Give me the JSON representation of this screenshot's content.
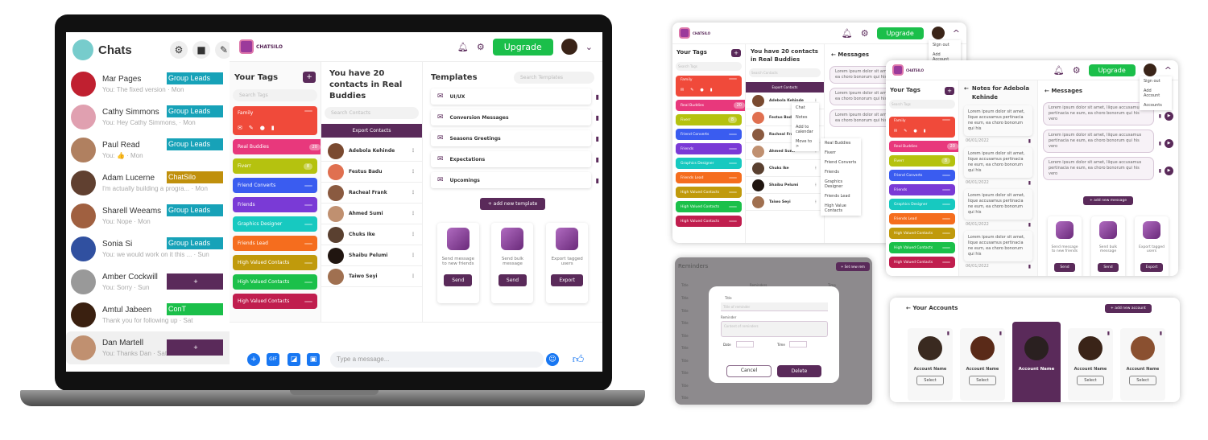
{
  "colors": {
    "brand": "#5a2a5a",
    "upgrade": "#1bbf4a",
    "messenger": "#1877f2"
  },
  "brand": {
    "logo_text": "CHATSILO"
  },
  "messenger": {
    "title": "Chats",
    "icons": [
      "gear-icon",
      "video-icon",
      "compose-icon"
    ],
    "chats": [
      {
        "name": "Mar Pages",
        "preview": "You: The fixed version · Mon",
        "tag": "Group Leads",
        "tag_color": "#17a2b8",
        "avatar": "#c02030"
      },
      {
        "name": "Cathy Simmons",
        "preview": "You: Hey Cathy Simmons,      · Mon",
        "tag": "Group Leads",
        "tag_color": "#17a2b8",
        "avatar": "#e0a0b0"
      },
      {
        "name": "Paul Read",
        "preview": "You: 👍 · Mon",
        "tag": "Group Leads",
        "tag_color": "#17a2b8",
        "avatar": "#b08060"
      },
      {
        "name": "Adam Lucerne",
        "preview": "I'm actually building a progra... · Mon",
        "tag": "ChatSilo",
        "tag_color": "#c0900c",
        "avatar": "#604030"
      },
      {
        "name": "Sharell Weeams",
        "preview": "You: Nope · Mon",
        "tag": "Group Leads",
        "tag_color": "#17a2b8",
        "avatar": "#a06040"
      },
      {
        "name": "Sonia Si",
        "preview": "You: we would work on it this ... · Sun",
        "tag": "Group Leads",
        "tag_color": "#17a2b8",
        "avatar": "#3050a0"
      },
      {
        "name": "Amber Cockwill",
        "preview": "You: Sorry · Sun",
        "tag": "+",
        "tag_color": "#5a2a5a",
        "avatar": "#999"
      },
      {
        "name": "Amtul Jabeen",
        "preview": "Thank you for following up · Sat",
        "tag": "ConT",
        "tag_color": "#1bbf4a",
        "avatar": "#3a2010"
      },
      {
        "name": "Dan Martell",
        "preview": "You: Thanks Dan · Sat",
        "tag": "+",
        "tag_color": "#5a2a5a",
        "avatar": "#c09070"
      }
    ],
    "composer_placeholder": "Type a message...",
    "composer_icons": [
      "plus-icon",
      "gif-icon",
      "sticker-icon",
      "image-icon",
      "emoji-icon",
      "thumbs-up-icon"
    ]
  },
  "app": {
    "upgrade": "Upgrade",
    "tags_title": "Your Tags",
    "add": "+",
    "search_tags": "Search Tags",
    "contacts_title": "You have 20 contacts in Real Buddies",
    "search_contacts": "Search Contacts",
    "export_contacts": "Export Contacts",
    "tags": [
      {
        "label": "Family",
        "color": "#f04a3a",
        "count": ""
      },
      {
        "label": "Real Buddies",
        "color": "#e8387c",
        "count": "20"
      },
      {
        "label": "Fiverr",
        "color": "#b5c20f",
        "count": "8"
      },
      {
        "label": "Friend Converts",
        "color": "#3a5cf0",
        "count": ""
      },
      {
        "label": "Friends",
        "color": "#7a3ad6",
        "count": ""
      },
      {
        "label": "Graphics Designer",
        "color": "#17c9c0",
        "count": ""
      },
      {
        "label": "Friends Lead",
        "color": "#f56d1e",
        "count": ""
      },
      {
        "label": "High Valued Contacts",
        "color": "#c09a0c",
        "count": ""
      },
      {
        "label": "High Valued Contacts",
        "color": "#1bc04a",
        "count": ""
      },
      {
        "label": "High Valued Contacts",
        "color": "#c01e4e",
        "count": ""
      }
    ],
    "contacts": [
      {
        "name": "Adebola Kehinde",
        "avatar": "#7a4a30"
      },
      {
        "name": "Festus Badu",
        "avatar": "#e07050"
      },
      {
        "name": "Racheal Frank",
        "avatar": "#8a5a40"
      },
      {
        "name": "Ahmed Sumi",
        "avatar": "#c09070"
      },
      {
        "name": "Chuks Ike",
        "avatar": "#5a4030"
      },
      {
        "name": "Shaibu Pelumi",
        "avatar": "#201510"
      },
      {
        "name": "Taiwo Seyi",
        "avatar": "#a07050"
      }
    ],
    "templates_title": "Templates",
    "search_templates": "Search Templates",
    "templates": [
      "UI/UX",
      "Conversion Messages",
      "Seasons Greetings",
      "Expectations",
      "Upcomings"
    ],
    "add_template": "+  add new template",
    "actions": [
      {
        "text": "Send message to new friends",
        "button": "Send"
      },
      {
        "text": "Send bulk message",
        "button": "Send"
      },
      {
        "text": "Export tagged users",
        "button": "Export"
      }
    ]
  },
  "panel1": {
    "messages_title": "Messages",
    "search": "Search Templ",
    "messages": [
      "Lorem ipsum dolor sit amet, ocusamus pertinacia ne eum, ea choro bonorum qui his vero",
      "Lorem ipsum dolor sit amet, ocusamus pertinacia ne eum, ea choro bonorum qui his vero",
      "Lorem ipsum dolor sit amet, ocusamus pertinacia ne eum, ea choro bonorum qui his vero"
    ],
    "context_menu": [
      "Chat",
      "Notes",
      "Add to calendar",
      "Move to  >"
    ],
    "move_menu": [
      "Real Buddies",
      "Fiverr",
      "Friend Converts",
      "Friends",
      "Graphics Designer",
      "Friends Lead",
      "High Value Contacts"
    ],
    "user_menu": [
      "Sign out",
      "Add Account"
    ]
  },
  "panel2": {
    "notes_title": "Notes for Adebola Kehinde",
    "messages_title": "Messages",
    "search": "Search Templ",
    "notes": [
      {
        "text": "Lorem ipsum dolor sit amet, lique accusamus pertinacia ne eum, ea choro bonorum qui his",
        "date": "06/01/2022"
      },
      {
        "text": "Lorem ipsum dolor sit amet, lique accusamus pertinacia ne eum, ea choro bonorum qui his",
        "date": "06/01/2022"
      },
      {
        "text": "Lorem ipsum dolor sit amet, lique accusamus pertinacia ne eum, ea choro bonorum qui his",
        "date": "06/01/2022"
      },
      {
        "text": "Lorem ipsum dolor sit amet, lique accusamus pertinacia ne eum, ea choro bonorum qui his",
        "date": "06/01/2022"
      }
    ],
    "messages": [
      "Lorem ipsum dolor sit amet, liique accusamus pertinacia ne eum, ea choro bonorum qui his vero",
      "Lorem ipsum dolor sit amet, liique accusamus pertinacia ne eum, ea choro bonorum qui his vero",
      "Lorem ipsum dolor sit amet, liique accusamus pertinacia ne eum, ea choro bonorum qui his vero"
    ],
    "add_message": "+  add new message",
    "user_menu": [
      "Sign out",
      "Add Account",
      "Accounts"
    ]
  },
  "reminders": {
    "title": "Reminders",
    "new": "+  Set new rem",
    "col_title": "Title",
    "col_reminder": "Reminders",
    "col_time": "Time",
    "rows": [
      "Title",
      "Title",
      "Title",
      "Title",
      "Title",
      "Title",
      "Title",
      "Title",
      "Title"
    ],
    "modal": {
      "title_label": "Title",
      "title_placeholder": "Title of reminder",
      "reminder_label": "Reminder",
      "reminder_placeholder": "Content of reminders",
      "date_label": "Date",
      "time_label": "Time",
      "cancel": "Cancel",
      "delete": "Delete"
    }
  },
  "accounts": {
    "title": "Your Accounts",
    "add": "+  add new account",
    "items": [
      {
        "name": "Account Name",
        "button": "Select",
        "selected": false
      },
      {
        "name": "Account Name",
        "button": "Select",
        "selected": false
      },
      {
        "name": "Account Name",
        "button": "",
        "selected": true
      },
      {
        "name": "Account Name",
        "button": "Select",
        "selected": false
      },
      {
        "name": "Account Name",
        "button": "Select",
        "selected": false
      }
    ]
  }
}
